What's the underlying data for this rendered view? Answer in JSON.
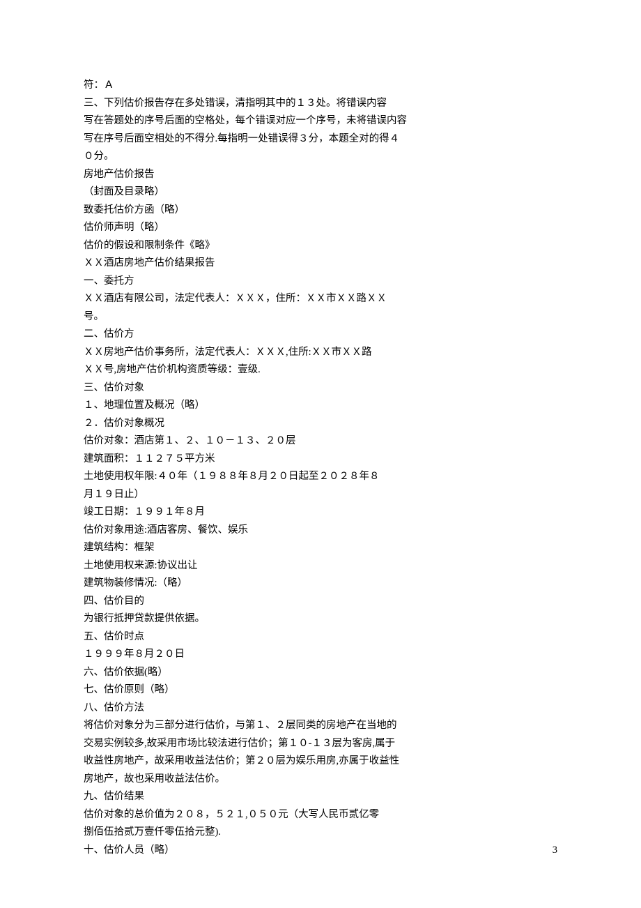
{
  "lines": [
    "符：Ａ",
    "三、下列估价报告存在多处错误，清指明其中的１３处。将错误内容",
    "写在答题处的序号后面的空格处，每个错误对应一个序号，未将错误内容",
    "写在序号后面空相处的不得分.每指明一处错误得３分，本题全对的得４",
    "０分。",
    "房地产估价报告",
    "（封面及目录略）",
    "致委托估价方函（略）",
    "估价师声明（略）",
    "估价的假设和限制条件《略》",
    "ＸＸ酒店房地产估价结果报告",
    "一、委托方",
    "ＸＸ酒店有限公司，法定代表人：ＸＸＸ，住所：ＸＸ市ＸＸ路ＸＸ",
    "号。",
    "二、估价方",
    "ＸＸ房地产估价事务所，法定代表人：ＸＸＸ,住所:ＸＸ市ＸＸ路",
    "ＸＸ号,房地产估价机构资质等级：壹级.",
    "三、估价对象",
    "１、地理位置及概况（略）",
    "２．估价对象概况",
    "估价对象：酒店第１、２、１０－１３、２０层",
    "建筑面积：１１２７５平方米",
    "土地使用权年限:４０年（１９８８年８月２０日起至２０２８年８",
    "月１９日止）",
    "竣工日期：１９９１年８月",
    "估价对象用途:酒店客房、餐饮、娱乐",
    "建筑结构：框架",
    "土地使用权来源:协议出让",
    "建筑物装修情况:（略）",
    "四、估价目的",
    "为银行抵押贷款提供依据。",
    "五、估价时点",
    "１９９９年８月２０日",
    "六、估价依据(略）",
    "七、估价原则（略）",
    "八、估价方法",
    "将估价对象分为三部分进行估价，与第１、２层同类的房地产在当地的",
    "交易实例较多,故采用市场比较法进行估价；第１０-１３层为客房,属于",
    "收益性房地产，故采用收益法估价；第２０层为娱乐用房,亦属于收益性",
    "房地产，故也采用收益法估价。",
    "九、估价结果",
    "估价对象的总价值为２０８，５２１,０５０元（大写人民币贰亿零",
    "捌佰伍拾贰万壹仟零伍拾元整).",
    "十、估价人员（略）"
  ],
  "page_number": "3"
}
